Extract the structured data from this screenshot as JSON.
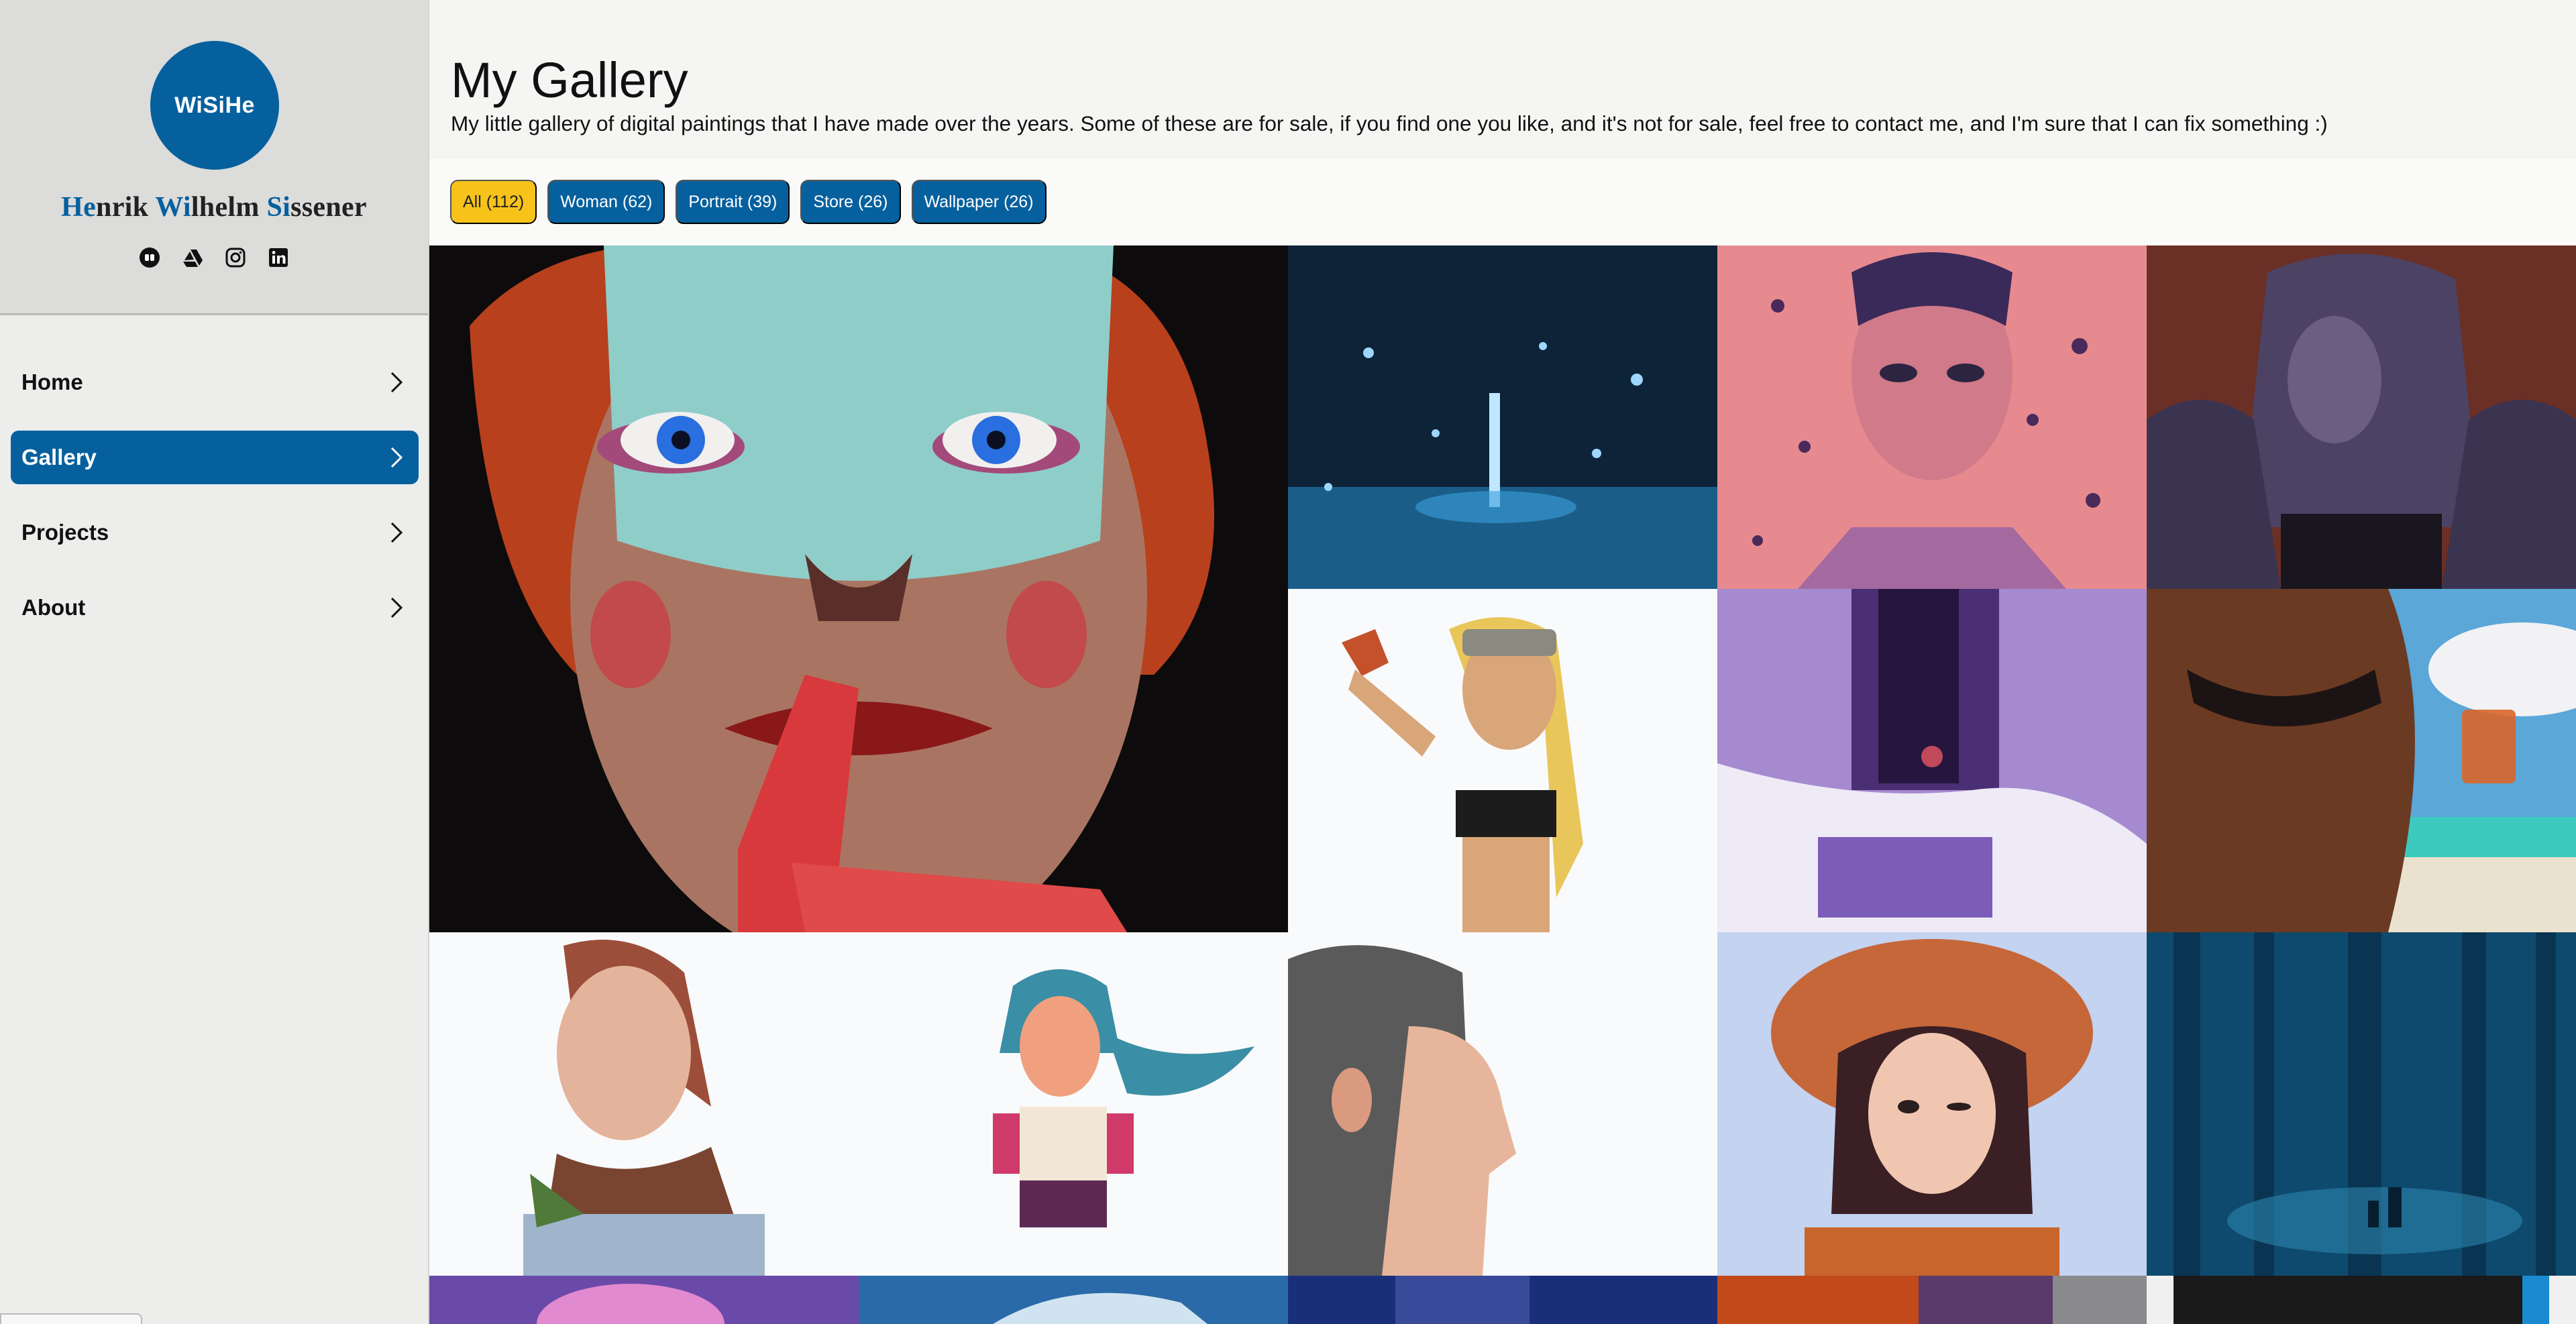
{
  "sidebar": {
    "logo_text": "WiSiHe",
    "name_parts": [
      {
        "text": "He",
        "hl": true
      },
      {
        "text": "nrik ",
        "hl": false
      },
      {
        "text": "Wi",
        "hl": true
      },
      {
        "text": "lhelm ",
        "hl": false
      },
      {
        "text": "Si",
        "hl": true
      },
      {
        "text": "ssener",
        "hl": false
      }
    ],
    "socials": [
      "redbubble-icon",
      "artstation-icon",
      "instagram-icon",
      "linkedin-icon"
    ],
    "nav": [
      {
        "label": "Home",
        "active": false
      },
      {
        "label": "Gallery",
        "active": true
      },
      {
        "label": "Projects",
        "active": false
      },
      {
        "label": "About",
        "active": false
      }
    ]
  },
  "main": {
    "title": "My Gallery",
    "description": "My little gallery of digital paintings that I have made over the years. Some of these are for sale, if you find one you like, and it's not for sale, feel free to contact me, and I'm sure that I can fix something :)",
    "filters": [
      {
        "label": "All (112)",
        "active": true
      },
      {
        "label": "Woman (62)",
        "active": false
      },
      {
        "label": "Portrait (39)",
        "active": false
      },
      {
        "label": "Store (26)",
        "active": false
      },
      {
        "label": "Wallpaper (26)",
        "active": false
      }
    ]
  },
  "colors": {
    "accent": "#07609e",
    "active_filter": "#f7c31a",
    "sidebar_bg": "#ededeb",
    "profile_bg": "#dcdcda"
  }
}
